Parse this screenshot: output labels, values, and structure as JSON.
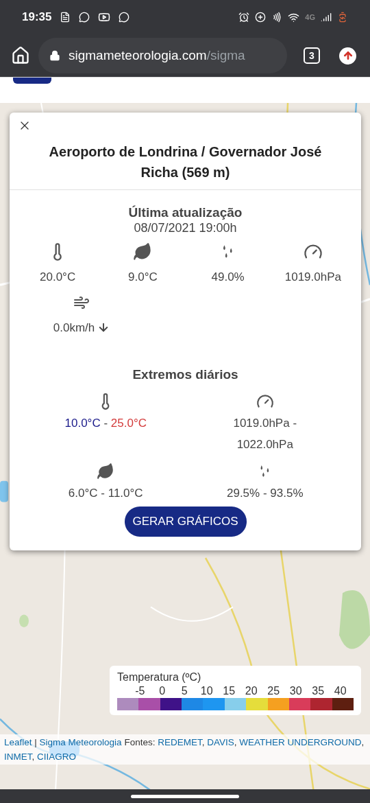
{
  "status_bar": {
    "time": "19:35",
    "network": "4G"
  },
  "browser": {
    "url_host": "sigmameteorologia.com",
    "url_path": "/sigma",
    "tab_count": "3"
  },
  "popup": {
    "title": "Aeroporto de Londrina / Governador José Richa (569 m)",
    "update_heading": "Última atualização",
    "update_time": "08/07/2021 19:00h",
    "current": [
      {
        "kind": "temperature",
        "value": "20.0°C"
      },
      {
        "kind": "dew_point",
        "value": "9.0°C"
      },
      {
        "kind": "humidity",
        "value": "49.0%"
      },
      {
        "kind": "pressure",
        "value": "1019.0hPa"
      }
    ],
    "wind": {
      "value": "0.0km/h"
    },
    "extremes_heading": "Extremos diários",
    "extremes": [
      {
        "kind": "temperature",
        "min": "10.0°C",
        "separator": "-",
        "max": "25.0°C"
      },
      {
        "kind": "pressure",
        "min": "1019.0hPa",
        "separator": "-",
        "max": "1022.0hPa"
      },
      {
        "kind": "dew_point",
        "min": "6.0°C",
        "separator": "-",
        "max": "11.0°C"
      },
      {
        "kind": "humidity",
        "min": "29.5%",
        "separator": "-",
        "max": "93.5%"
      }
    ],
    "button": "GERAR GRÁFICOS"
  },
  "legend": {
    "title": "Temperatura (ºC)",
    "labels": [
      "-5",
      "0",
      "5",
      "10",
      "15",
      "20",
      "25",
      "30",
      "35",
      "40"
    ],
    "swatches": [
      {
        "color": "#ad8bbd"
      },
      {
        "color": "#a94fa8"
      },
      {
        "color": "#3f1288"
      },
      {
        "color": "#1e88e5"
      },
      {
        "color": "#1e96f0"
      },
      {
        "color": "#87ceeb"
      },
      {
        "color": "#e5dd3b"
      },
      {
        "color": "#f5a020"
      },
      {
        "color": "#d93c5a"
      },
      {
        "color": "#ae2530"
      },
      {
        "color": "#5e1f10"
      }
    ]
  },
  "attribution": [
    {
      "text": "Leaflet",
      "link": true
    },
    {
      "text": " | ",
      "link": false
    },
    {
      "text": "Sigma Meteorologia",
      "link": true
    },
    {
      "text": " Fontes: ",
      "link": false
    },
    {
      "text": "REDEMET",
      "link": true
    },
    {
      "text": ", ",
      "link": false
    },
    {
      "text": "DAVIS",
      "link": true
    },
    {
      "text": ", ",
      "link": false
    },
    {
      "text": "WEATHER UNDERGROUND",
      "link": true
    },
    {
      "text": ", ",
      "link": false
    },
    {
      "text": "INMET",
      "link": true
    },
    {
      "text": ", ",
      "link": false
    },
    {
      "text": "CIIAGRO",
      "link": true
    }
  ]
}
